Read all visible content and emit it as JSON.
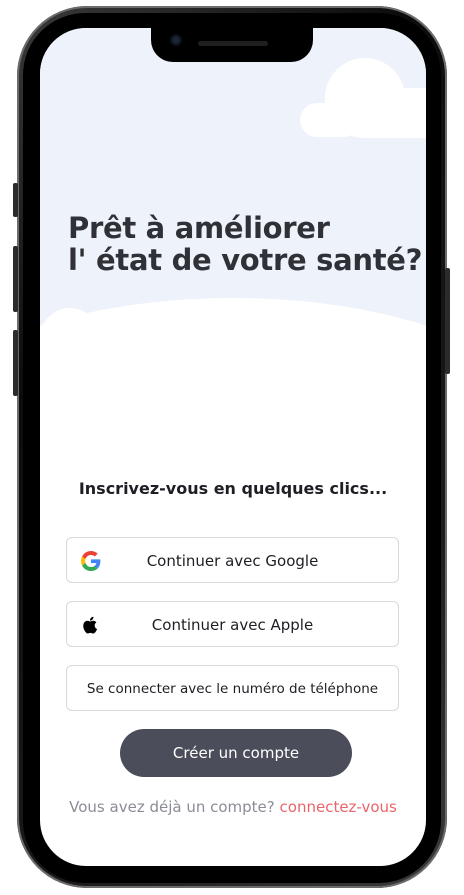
{
  "headline": {
    "line1": "Prêt à améliorer",
    "line2": "l' état de votre santé?"
  },
  "subtitle": "Inscrivez-vous en quelques clics...",
  "buttons": {
    "google": {
      "label": "Continuer avec Google",
      "icon": "google-icon"
    },
    "apple": {
      "label": "Continuer avec  Apple",
      "icon": "apple-icon"
    },
    "phone": {
      "label": "Se connecter avec le numéro de téléphone"
    }
  },
  "create_account": {
    "label": "Créer un compte",
    "color": "#4b4e5a"
  },
  "login": {
    "prompt": "Vous avez déjà un compte?",
    "link": "connectez-vous",
    "link_color": "#e9656b"
  }
}
